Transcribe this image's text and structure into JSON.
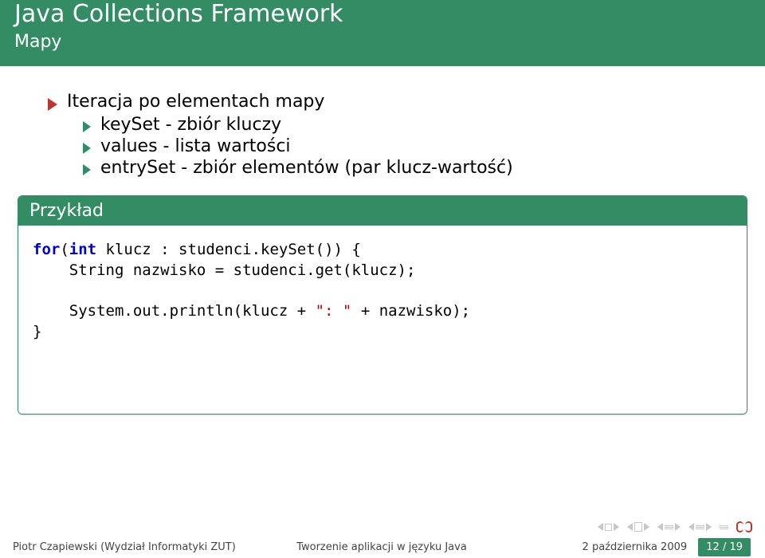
{
  "header": {
    "title": "Java Collections Framework",
    "subtitle": "Mapy"
  },
  "content": {
    "main_bullet": "Iteracja po elementach mapy",
    "sub_bullets": [
      "keySet - zbiór kluczy",
      "values - lista wartości",
      "entrySet - zbiór elementów (par klucz-wartość)"
    ]
  },
  "example": {
    "label": "Przykład",
    "code": {
      "kw_for": "for",
      "kw_int": "int",
      "seg_a": "(",
      "seg_b": " klucz : studenci.keySet()) {",
      "seg_c": "    String nazwisko = studenci.get(klucz);",
      "seg_d": "    System.out.println(klucz + ",
      "str": "\": \"",
      "seg_e": " + nazwisko);",
      "seg_f": "}"
    }
  },
  "footer": {
    "author": "Piotr Czapiewski (Wydział Informatyki ZUT)",
    "center": "Tworzenie aplikacji w języku Java",
    "date": "2 października 2009",
    "page": "12 / 19"
  }
}
